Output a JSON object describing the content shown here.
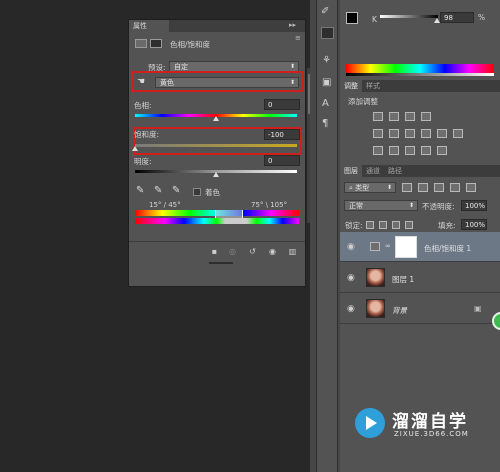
{
  "properties_panel": {
    "tab": "属性",
    "collapse_glyph": "▸▸",
    "menu_glyph": "≡",
    "header_title": "色相/饱和度",
    "preset_label": "预设:",
    "preset_value": "自定",
    "channel_value": "黄色",
    "hue_label": "色相:",
    "hue_value": "0",
    "saturation_label": "饱和度:",
    "saturation_value": "-100",
    "lightness_label": "明度:",
    "lightness_value": "0",
    "colorize_label": "着色",
    "range_left": "15° / 45°",
    "range_right": "75° \\ 105°",
    "saturation_level": -1.0
  },
  "color_panel": {
    "k_label": "K",
    "k_value": "98",
    "k_unit": "%",
    "k_level": 0.98
  },
  "adjustments_panel": {
    "tabs": [
      {
        "label": "调整",
        "active": true
      },
      {
        "label": "样式",
        "active": false
      }
    ],
    "add_label": "添加调整"
  },
  "layers_panel": {
    "tabs": [
      {
        "label": "图层",
        "active": true
      },
      {
        "label": "通道",
        "active": false
      },
      {
        "label": "路径",
        "active": false
      }
    ],
    "filter_kind": "类型",
    "blend_mode": "正常",
    "opacity_label": "不透明度:",
    "opacity_value": "100%",
    "lock_label": "锁定:",
    "fill_label": "填充:",
    "fill_value": "100%",
    "layers": [
      {
        "name": "色相/饱和度 1"
      },
      {
        "name": "图层 1"
      },
      {
        "name": "背景"
      }
    ]
  },
  "watermark": {
    "title": "溜溜自学",
    "url": "ZIXUE.3D66.COM"
  },
  "colors": {
    "accent_red": "#d0201e",
    "panel_bg": "#535353",
    "canvas_bg": "#282828"
  }
}
